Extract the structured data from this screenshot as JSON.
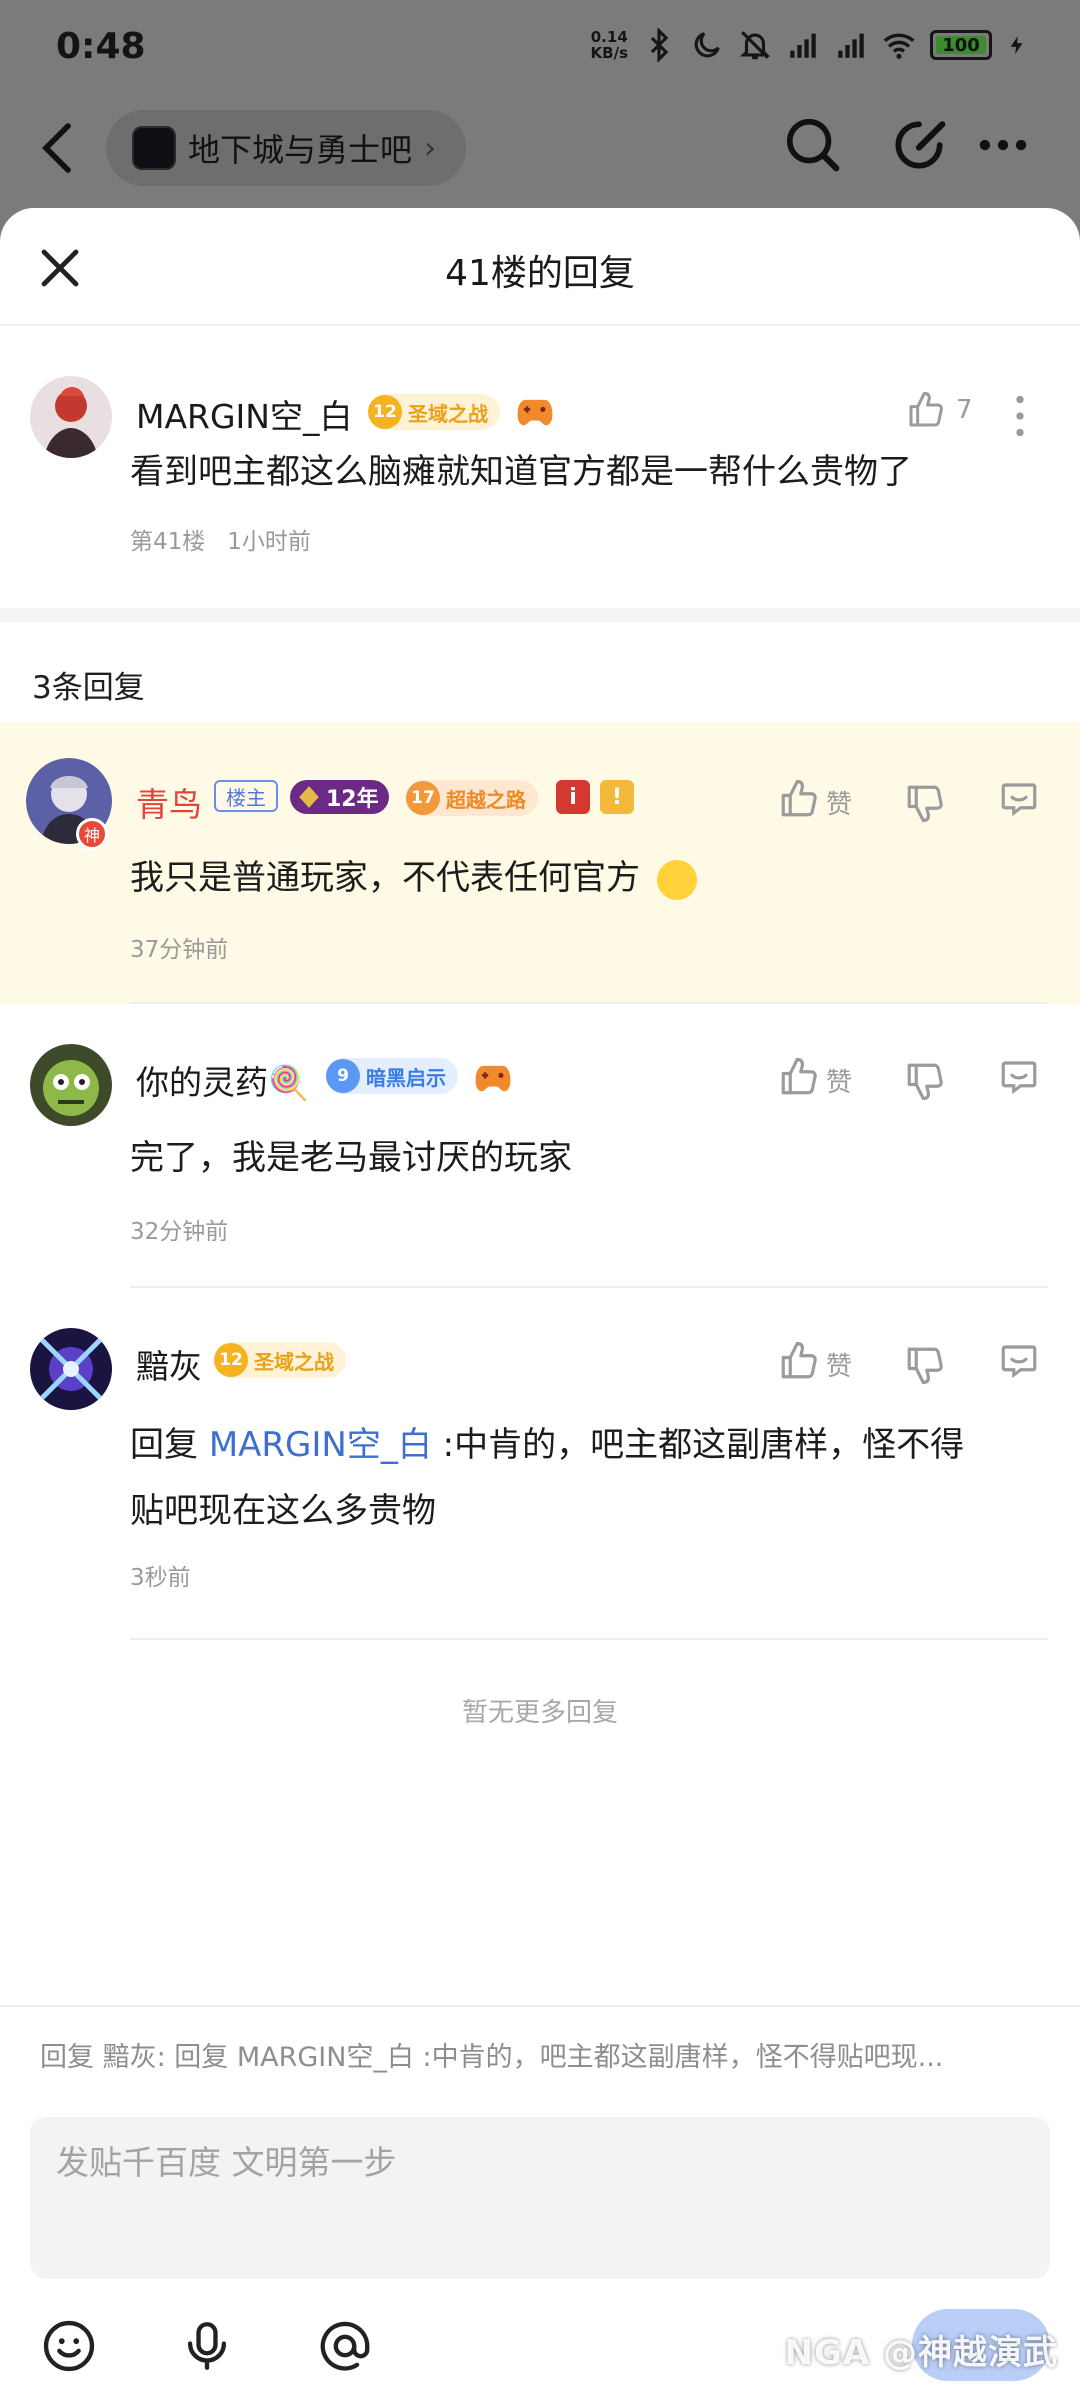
{
  "status_bar": {
    "time": "0:48",
    "net_speed_value": "0.14",
    "net_speed_unit": "KB/s",
    "battery": "100"
  },
  "nav": {
    "forum_name": "地下城与勇士吧"
  },
  "sheet": {
    "title": "41楼的回复"
  },
  "main_post": {
    "username": "MARGIN空_白",
    "level": "12",
    "badge_title": "圣域之战",
    "likes": "7",
    "content": "看到吧主都这么脑瘫就知道官方都是一帮什么贵物了",
    "floor": "第41楼",
    "time": "1小时前"
  },
  "reply_count": "3条回复",
  "replies": [
    {
      "username": "青鸟",
      "owner_tag": "楼主",
      "years": "12年",
      "level": "17",
      "badge_title": "超越之路",
      "like_label": "赞",
      "content": "我只是普通玩家，不代表任何官方",
      "time": "37分钟前",
      "avatar_badge": "神"
    },
    {
      "username": "你的灵药🍭",
      "level": "9",
      "badge_title": "暗黑启示",
      "like_label": "赞",
      "content": "完了，我是老马最讨厌的玩家",
      "time": "32分钟前"
    },
    {
      "username": "黯灰",
      "level": "12",
      "badge_title": "圣域之战",
      "like_label": "赞",
      "content_prefix": "回复",
      "mention": "MARGIN空_白",
      "content_suffix": ":中肯的，吧主都这副唐样，怪不得",
      "content_line2": "贴吧现在这么多贵物",
      "time": "3秒前"
    }
  ],
  "no_more": "暂无更多回复",
  "composer": {
    "reply_hint": "回复 黯灰: 回复 MARGIN空_白 :中肯的，吧主都这副唐样，怪不得贴吧现...",
    "placeholder": "发贴千百度 文明第一步",
    "watermark": "NGA @神越演武"
  },
  "colors": {
    "highlight_bg": "#fffae6",
    "mention": "#3d6fd1",
    "owner_name": "#e0443a"
  }
}
